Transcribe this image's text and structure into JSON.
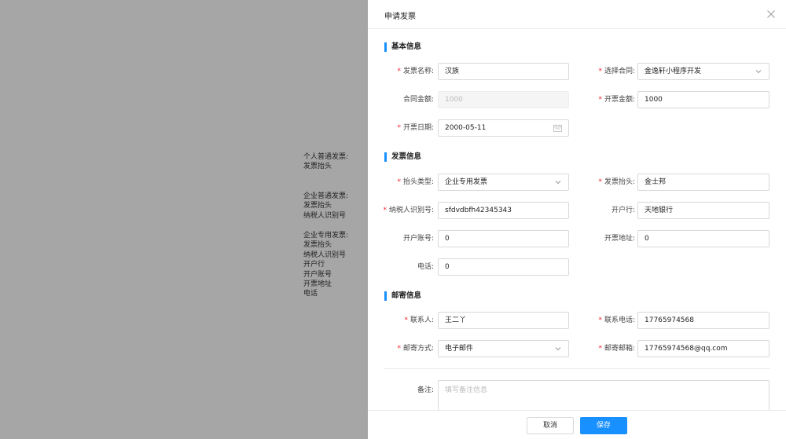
{
  "hints": {
    "personal": [
      "个人普通发票:",
      "发票抬头"
    ],
    "company_normal": [
      "企业普通发票:",
      "发票抬头",
      "纳税人识别号"
    ],
    "company_special": [
      "企业专用发票:",
      "发票抬头",
      "纳税人识别号",
      "开户行",
      "开户账号",
      "开票地址",
      "电话"
    ]
  },
  "drawer": {
    "title": "申请发票"
  },
  "sections": {
    "basic": "基本信息",
    "invoice": "发票信息",
    "mail": "邮寄信息"
  },
  "basic": {
    "invoice_name_label": "发票名称:",
    "invoice_name_value": "汉族",
    "contract_label": "选择合同:",
    "contract_value": "金逸轩小程序开发",
    "contract_amount_label": "合同金额:",
    "contract_amount_value": "1000",
    "invoice_amount_label": "开票金额:",
    "invoice_amount_value": "1000",
    "invoice_date_label": "开票日期:",
    "invoice_date_value": "2000-05-11"
  },
  "invoice": {
    "header_type_label": "抬头类型:",
    "header_type_value": "企业专用发票",
    "header_label": "发票抬头:",
    "header_value": "金士邦",
    "tax_id_label": "纳税人识别号:",
    "tax_id_value": "sfdvdbfh42345343",
    "bank_label": "开户行:",
    "bank_value": "天地银行",
    "account_label": "开户账号:",
    "account_value": "0",
    "address_label": "开票地址:",
    "address_value": "0",
    "phone_label": "电话:",
    "phone_value": "0"
  },
  "mail": {
    "contact_label": "联系人:",
    "contact_value": "王二丫",
    "contact_phone_label": "联系电话:",
    "contact_phone_value": "17765974568",
    "method_label": "邮寄方式:",
    "method_value": "电子邮件",
    "email_label": "邮寄邮箱:",
    "email_value": "17765974568@qq.com"
  },
  "remark": {
    "label": "备注:",
    "placeholder": "填写备注信息"
  },
  "footer": {
    "cancel": "取消",
    "save": "保存"
  },
  "colors": {
    "accent": "#1890ff",
    "required": "#f5222d",
    "overlay": "#a6a6a6"
  },
  "icons": {
    "close": "close-icon",
    "chevron": "chevron-down-icon",
    "calendar": "calendar-icon"
  }
}
